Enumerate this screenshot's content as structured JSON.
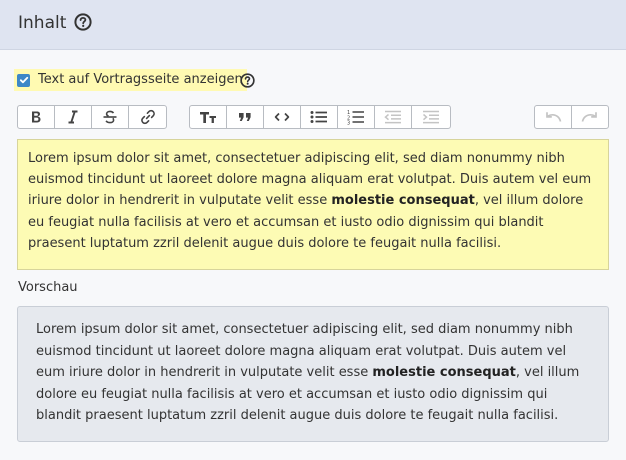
{
  "header": {
    "title": "Inhalt",
    "help_icon": "question-circle-icon"
  },
  "show_text": {
    "label": "Text auf Vortragsseite anzeigen",
    "checked": true,
    "help_icon": "question-circle-icon"
  },
  "toolbar": {
    "groups": [
      [
        "bold-icon",
        "italic-icon",
        "strikethrough-icon",
        "link-icon"
      ],
      [
        "heading-icon",
        "quote-icon",
        "code-icon",
        "bullet-list-icon",
        "numbered-list-icon",
        "outdent-icon",
        "indent-icon"
      ],
      [
        "undo-icon",
        "redo-icon"
      ]
    ]
  },
  "editor": {
    "text_before": "Lorem ipsum dolor sit amet, consectetuer adipiscing elit, sed diam nonummy nibh euismod tincidunt ut laoreet dolore magna aliquam erat volutpat. Duis autem vel eum iriure dolor in hendrerit in vulputate velit esse ",
    "bold": "molestie consequat",
    "text_after": ", vel illum dolore eu feugiat nulla facilisis at vero et accumsan et iusto odio dignissim qui blandit praesent luptatum zzril delenit augue duis dolore te feugait nulla facilisi."
  },
  "preview": {
    "label": "Vorschau",
    "text_before": "Lorem ipsum dolor sit amet, consectetuer adipiscing elit, sed diam nonummy nibh euismod tincidunt ut laoreet dolore magna aliquam erat volutpat. Duis autem vel eum iriure dolor in hendrerit in vulputate velit esse ",
    "bold": "molestie consequat",
    "text_after": ", vel illum dolore eu feugiat nulla facilisis at vero et accumsan et iusto odio dignissim qui blandit praesent luptatum zzril delenit augue duis dolore te feugait nulla facilisi."
  },
  "colors": {
    "header_bg": "#dfe4f1",
    "editor_bg": "#fdfbb4",
    "preview_bg": "#e6e9ee",
    "checkbox": "#3d87c7"
  }
}
